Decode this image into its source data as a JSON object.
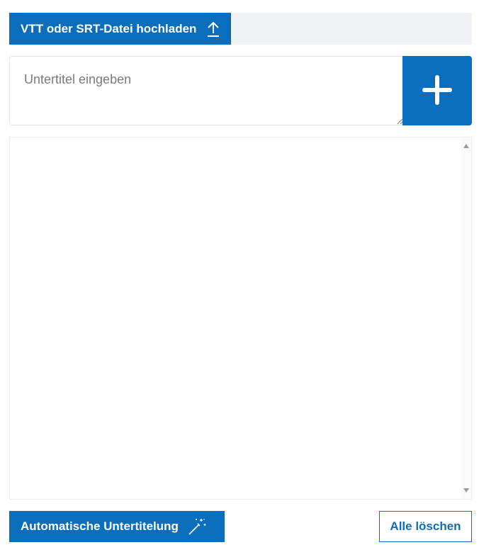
{
  "upload": {
    "label": "VTT oder SRT-Datei hochladen",
    "icon": "upload-arrow-icon"
  },
  "subtitle_input": {
    "placeholder": "Untertitel eingeben",
    "value": ""
  },
  "add_button": {
    "icon": "plus-icon"
  },
  "subtitle_list": {
    "items": []
  },
  "footer": {
    "auto_label": "Automatische Untertitelung",
    "auto_icon": "magic-wand-icon",
    "clear_label": "Alle löschen"
  },
  "colors": {
    "accent": "#0a6ebd",
    "bar_background": "#f0f2f5",
    "border": "#e3e5e8"
  }
}
